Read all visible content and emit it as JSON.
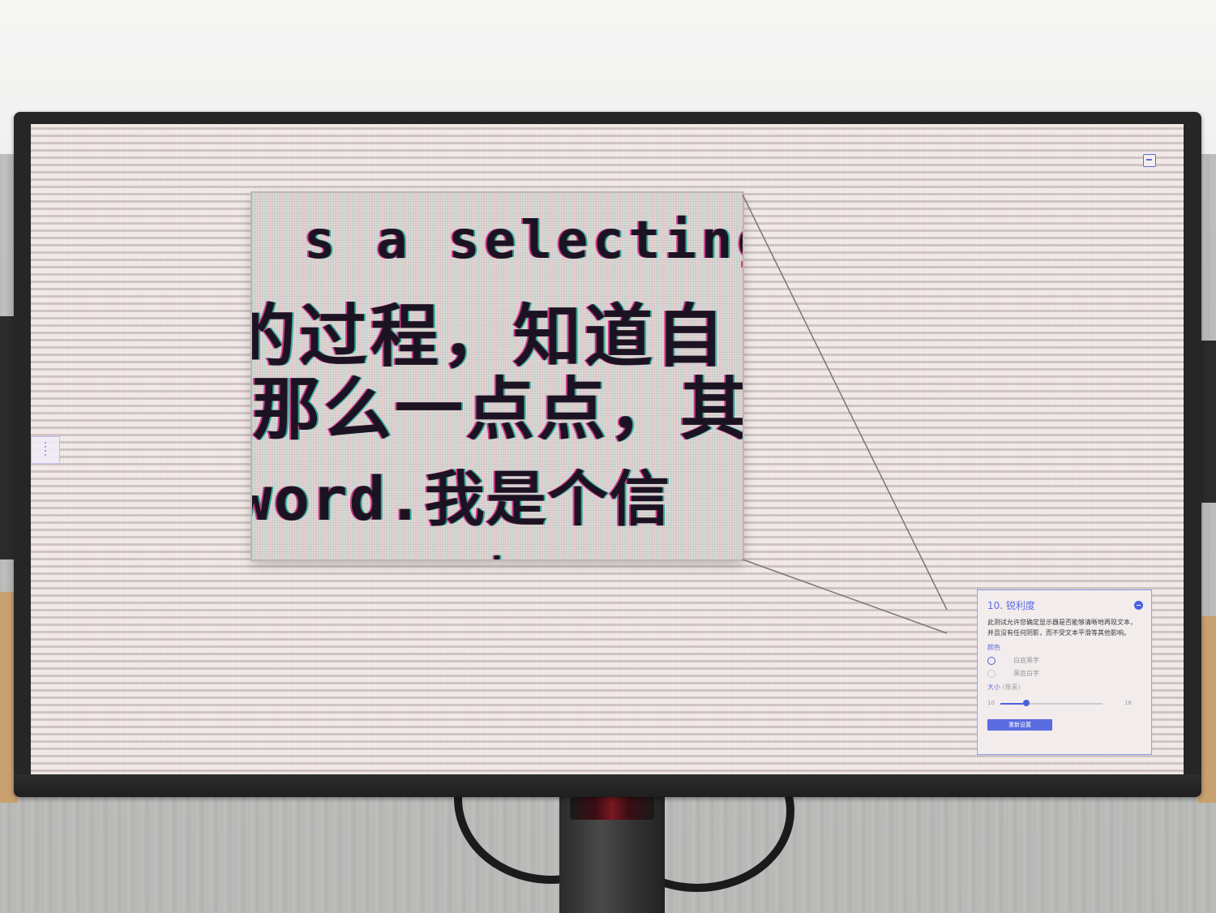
{
  "zoom_view": {
    "line1": "s a selecting",
    "line2": "的过程，知道自",
    "line3": "那么一点点，其",
    "line4": "word.我是个信",
    "line5": "."
  },
  "settings_panel": {
    "title": "10. 锐利度",
    "description": "此测试允许您确定显示器是否能够清晰地再现文本，并且没有任何阴影，而不受文本平滑等其他影响。",
    "color_label": "颜色",
    "color_options": [
      "白底黑字",
      "黑底白字"
    ],
    "selected_color_index": 0,
    "size_label": "大小",
    "size_unit": "(像素)",
    "slider_min": "10",
    "slider_max": "18",
    "slider_value": 12,
    "reset_label": "重新设置"
  },
  "colors": {
    "accent": "#5b6be0",
    "screen_bg": "#efe6e4",
    "bezel": "#262626"
  },
  "icons": [
    "exit-fullscreen-icon",
    "minimize-panel-icon",
    "drag-handle-icon"
  ]
}
